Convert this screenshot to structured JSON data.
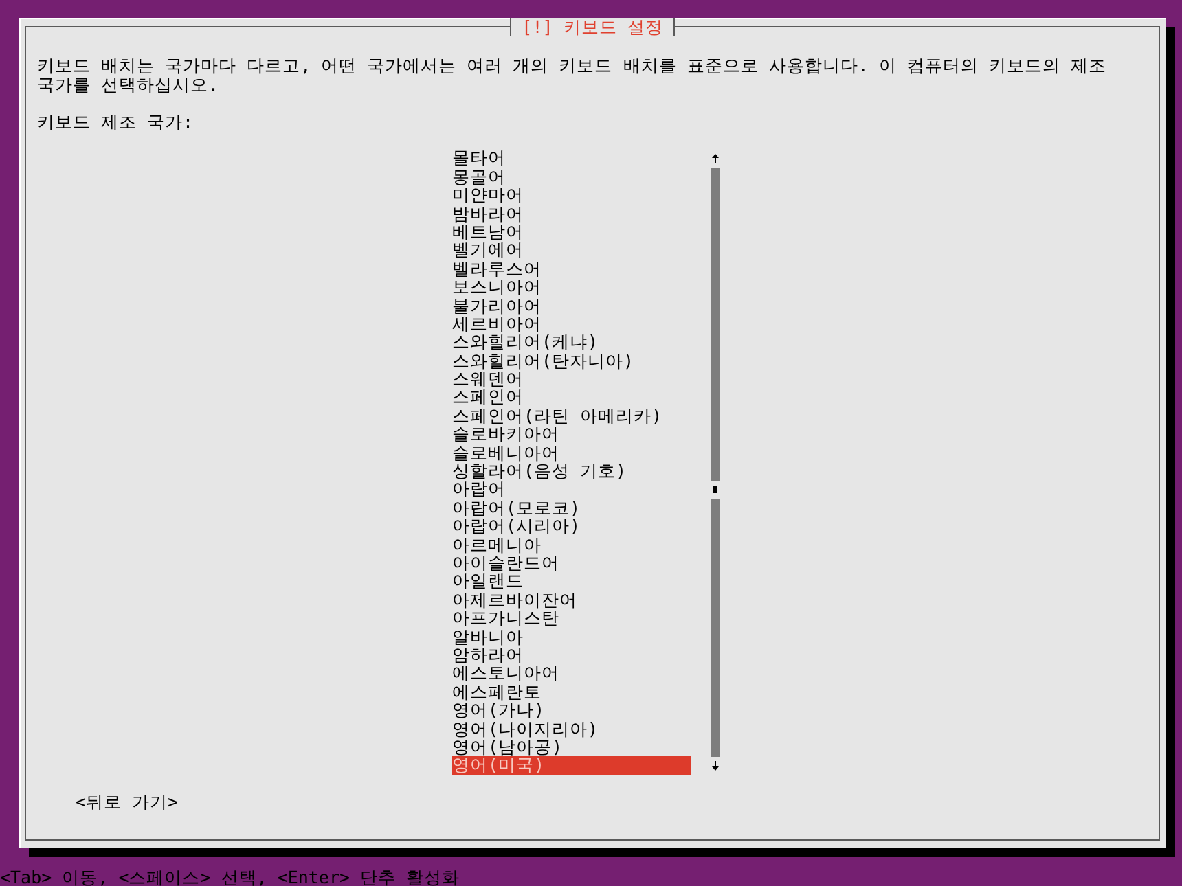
{
  "dialog": {
    "title": "[!] 키보드 설정",
    "description": "키보드 배치는 국가마다 다르고, 어떤 국가에서는 여러 개의 키보드 배치를 표준으로 사용합니다. 이 컴퓨터의 키보드의 제조 국가를 선택하십시오.",
    "list_label": "키보드 제조 국가:"
  },
  "country_list": {
    "items": [
      {
        "label": "몰타어",
        "selected": false
      },
      {
        "label": "몽골어",
        "selected": false
      },
      {
        "label": "미얀마어",
        "selected": false
      },
      {
        "label": "밤바라어",
        "selected": false
      },
      {
        "label": "베트남어",
        "selected": false
      },
      {
        "label": "벨기에어",
        "selected": false
      },
      {
        "label": "벨라루스어",
        "selected": false
      },
      {
        "label": "보스니아어",
        "selected": false
      },
      {
        "label": "불가리아어",
        "selected": false
      },
      {
        "label": "세르비아어",
        "selected": false
      },
      {
        "label": "스와힐리어(케냐)",
        "selected": false
      },
      {
        "label": "스와힐리어(탄자니아)",
        "selected": false
      },
      {
        "label": "스웨덴어",
        "selected": false
      },
      {
        "label": "스페인어",
        "selected": false
      },
      {
        "label": "스페인어(라틴 아메리카)",
        "selected": false
      },
      {
        "label": "슬로바키아어",
        "selected": false
      },
      {
        "label": "슬로베니아어",
        "selected": false
      },
      {
        "label": "싱할라어(음성 기호)",
        "selected": false
      },
      {
        "label": "아랍어",
        "selected": false
      },
      {
        "label": "아랍어(모로코)",
        "selected": false
      },
      {
        "label": "아랍어(시리아)",
        "selected": false
      },
      {
        "label": "아르메니아",
        "selected": false
      },
      {
        "label": "아이슬란드어",
        "selected": false
      },
      {
        "label": "아일랜드",
        "selected": false
      },
      {
        "label": "아제르바이잔어",
        "selected": false
      },
      {
        "label": "아프가니스탄",
        "selected": false
      },
      {
        "label": "알바니아",
        "selected": false
      },
      {
        "label": "암하라어",
        "selected": false
      },
      {
        "label": "에스토니아어",
        "selected": false
      },
      {
        "label": "에스페란토",
        "selected": false
      },
      {
        "label": "영어(가나)",
        "selected": false
      },
      {
        "label": "영어(나이지리아)",
        "selected": false
      },
      {
        "label": "영어(남아공)",
        "selected": false
      },
      {
        "label": "영어(미국)",
        "selected": true
      }
    ]
  },
  "back_button": {
    "label": "<뒤로 가기>"
  },
  "status_bar": {
    "text": "<Tab> 이동, <스페이스> 선택, <Enter> 단추 활성화"
  }
}
